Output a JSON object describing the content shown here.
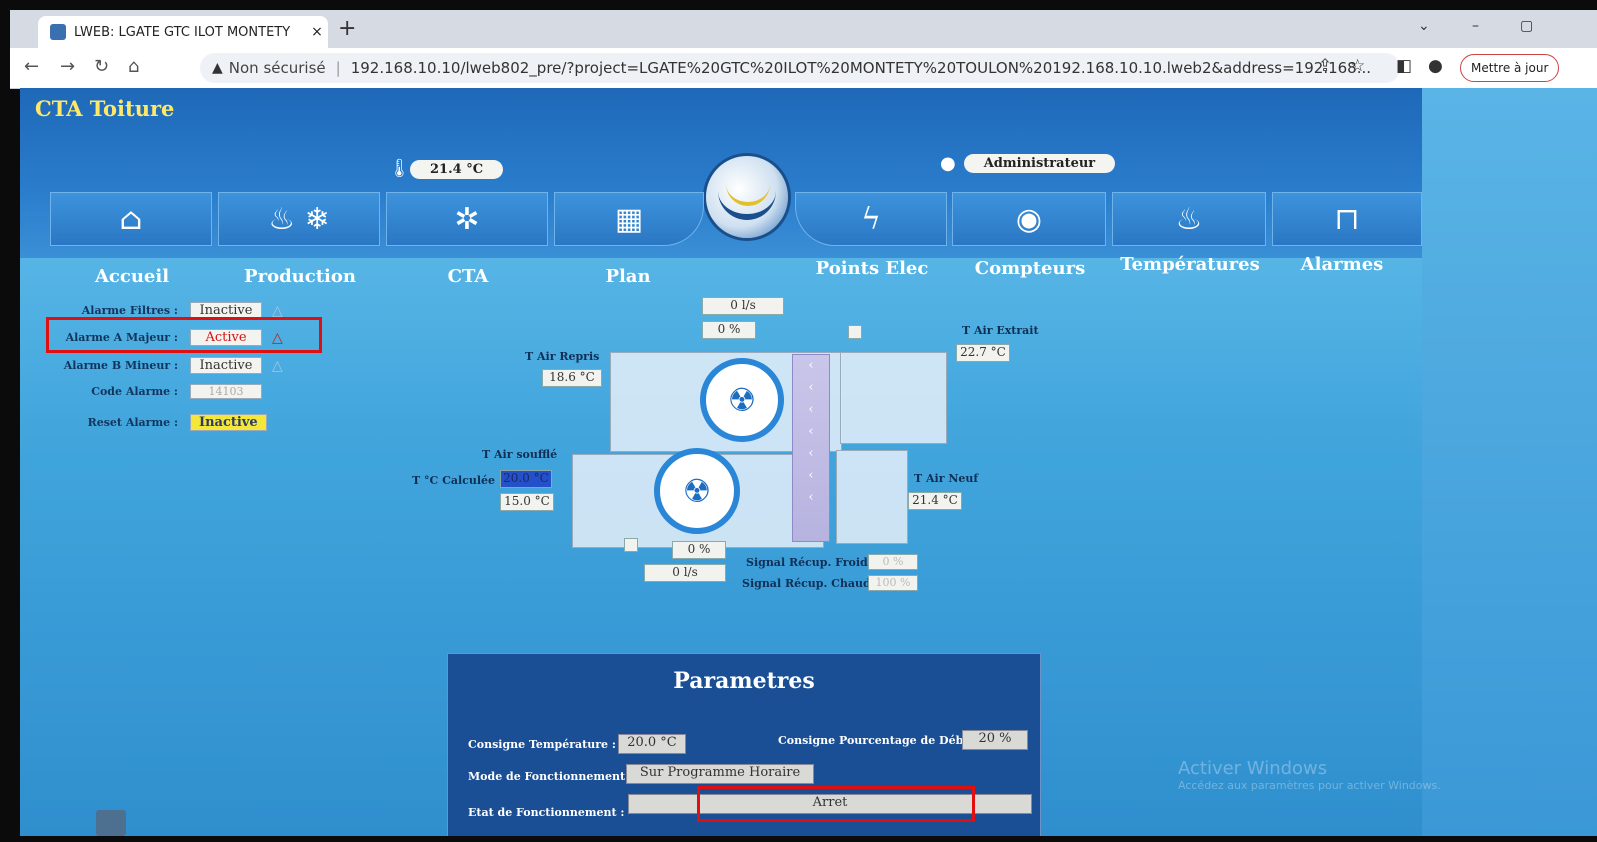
{
  "browser": {
    "tab_title": "LWEB: LGATE GTC ILOT MONTETY",
    "tab_close": "×",
    "new_tab": "+",
    "minimize": "–",
    "restore": "▢",
    "chevron": "⌄",
    "security_label": "Non sécurisé",
    "url": "192.168.10.10/lweb802_pre/?project=LGATE%20GTC%20ILOT%20MONTETY%20TOULON%20192.168.10.10.lweb2&address=192.168...",
    "update_button": "Mettre à jour"
  },
  "app": {
    "title": "CTA Toiture",
    "temperature": "21.4 °C",
    "user": "Administrateur"
  },
  "nav": [
    {
      "label": "Accueil",
      "glyph": "⌂"
    },
    {
      "label": "Production",
      "glyph": "♨ ❄"
    },
    {
      "label": "CTA",
      "glyph": "✲"
    },
    {
      "label": "Plan",
      "glyph": "▦"
    },
    {
      "label": "Points Elec",
      "glyph": "ϟ"
    },
    {
      "label": "Compteurs",
      "glyph": "◉"
    },
    {
      "label": "Températures",
      "glyph": "♨"
    },
    {
      "label": "Alarmes",
      "glyph": "⊓"
    }
  ],
  "alarms": {
    "filtres": {
      "label": "Alarme Filtres :",
      "value": "Inactive"
    },
    "majeur": {
      "label": "Alarme A Majeur :",
      "value": "Active"
    },
    "mineur": {
      "label": "Alarme B Mineur :",
      "value": "Inactive"
    },
    "code": {
      "label": "Code Alarme :",
      "value": "14103"
    },
    "reset": {
      "label": "Reset Alarme :",
      "value": "Inactive"
    }
  },
  "synoptic": {
    "debit_reprise": "0 l/s",
    "pct_reprise": "0 %",
    "t_air_repris_label": "T Air Repris",
    "t_air_repris": "18.6 °C",
    "t_air_extrait_label": "T Air Extrait",
    "t_air_extrait": "22.7 °C",
    "t_air_souffle_label": "T Air soufflé",
    "t_calculee_label": "T °C Calculée :",
    "t_calculee": "20.0 °C",
    "t_air_souffle": "15.0 °C",
    "t_air_neuf_label": "T Air Neuf",
    "t_air_neuf": "21.4 °C",
    "pct_soufflage": "0 %",
    "debit_soufflage": "0 l/s",
    "signal_froid_label": "Signal Récup. Froid :",
    "signal_froid": "0 %",
    "signal_chaud_label": "Signal Récup. Chaud :",
    "signal_chaud": "100 %"
  },
  "params": {
    "title": "Parametres",
    "consigne_temp_label": "Consigne Température :",
    "consigne_temp": "20.0 °C",
    "consigne_debit_label": "Consigne Pourcentage de Débit :",
    "consigne_debit": "20 %",
    "mode_label": "Mode de Fonctionnement :",
    "mode": "Sur Programme Horaire",
    "etat_label": "Etat de Fonctionnement :",
    "etat": "Arret"
  },
  "watermark": {
    "line1": "Activer Windows",
    "line2": "Accédez aux paramètres pour activer Windows."
  },
  "colors": {
    "title_yellow": "#ffe867",
    "alarm_red": "#d41414",
    "reset_yellow": "#f5e63a",
    "highlight_red": "#e01010"
  }
}
